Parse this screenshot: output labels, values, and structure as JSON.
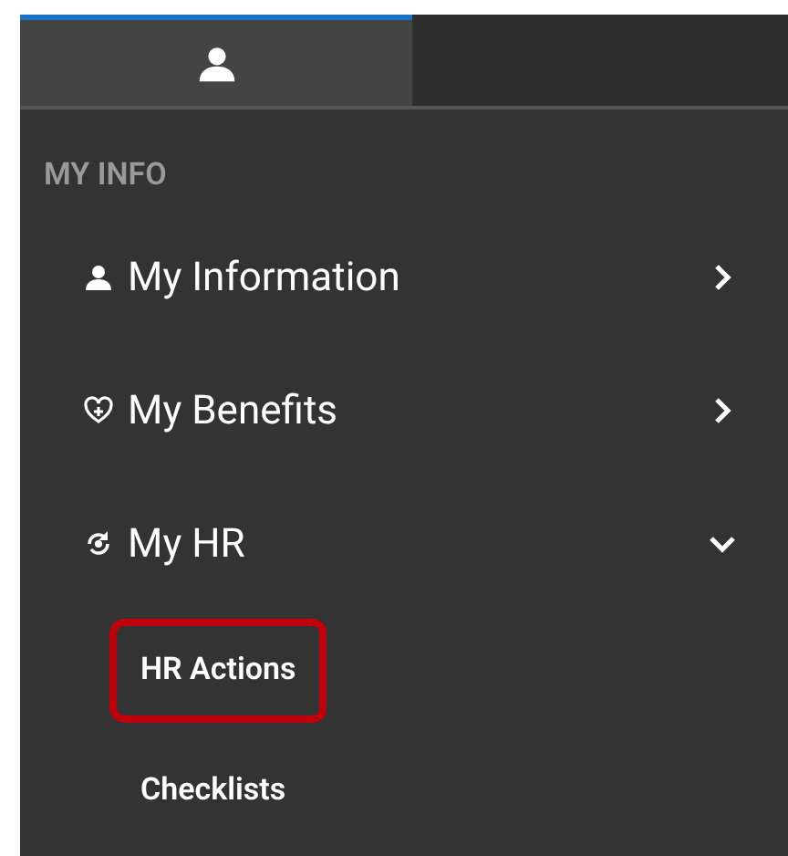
{
  "tabs": [
    {
      "selected": true
    },
    {
      "selected": false
    }
  ],
  "section_label": "MY INFO",
  "menu_items": [
    {
      "label": "My Information",
      "expanded": false
    },
    {
      "label": "My Benefits",
      "expanded": false
    },
    {
      "label": "My HR",
      "expanded": true,
      "children": [
        {
          "label": "HR Actions",
          "highlighted": true
        },
        {
          "label": "Checklists",
          "highlighted": false
        }
      ]
    }
  ]
}
